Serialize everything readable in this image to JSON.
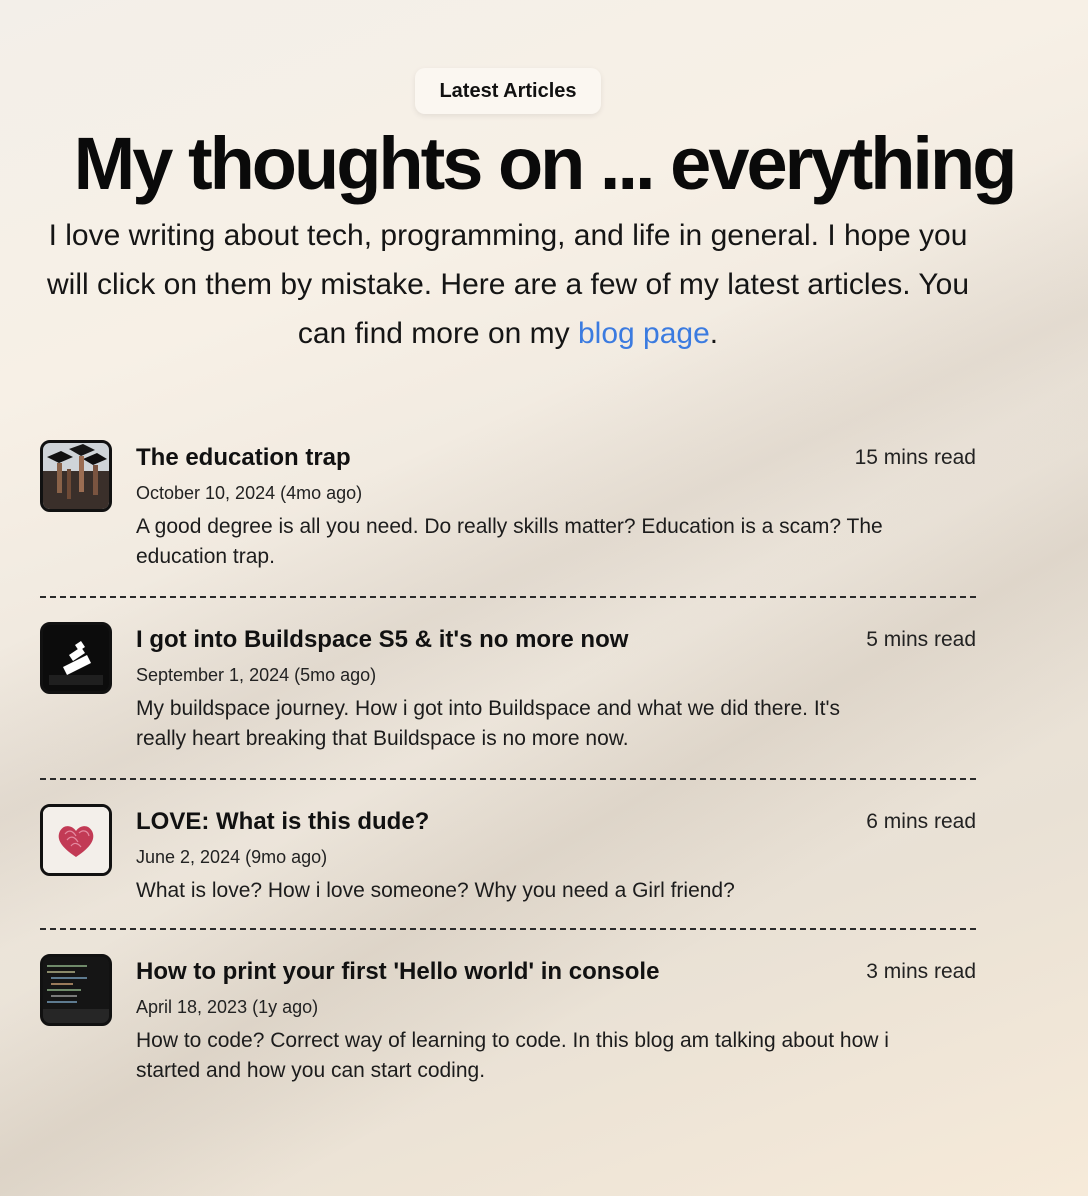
{
  "badge": "Latest Articles",
  "hero": {
    "title": "My thoughts on ... everything",
    "intro_before": "I love writing about tech, programming, and life in general. I hope you will click on them by mistake. Here are a few of my latest articles. You can find more on my ",
    "intro_link": "blog page",
    "intro_after": "."
  },
  "colors": {
    "link": "#3b7be0",
    "text": "#111111",
    "background": "#f3ede4"
  },
  "articles": [
    {
      "title": "The education trap",
      "read_time": "15 mins read",
      "date": "October 10, 2024 (4mo ago)",
      "description": "A good degree is all you need. Do really skills matter? Education is a scam? The education trap.",
      "thumbnail": "graduation-caps-image"
    },
    {
      "title": "I got into Buildspace S5 & it's no more now",
      "read_time": "5 mins read",
      "date": "September 1, 2024 (5mo ago)",
      "description": "My buildspace journey. How i got into Buildspace and what we did there. It's really heart breaking that Buildspace is no more now.",
      "thumbnail": "buildspace-logo-image"
    },
    {
      "title": "LOVE: What is this dude?",
      "read_time": "6 mins read",
      "date": "June 2, 2024 (9mo ago)",
      "description": "What is love? How i love someone? Why you need a Girl friend?",
      "thumbnail": "fingerprint-heart-image"
    },
    {
      "title": "How to print your first 'Hello world' in console",
      "read_time": "3 mins read",
      "date": "April 18, 2023 (1y ago)",
      "description": "How to code? Correct way of learning to code. In this blog am talking about how i started and how you can start coding.",
      "thumbnail": "code-screen-image"
    }
  ]
}
